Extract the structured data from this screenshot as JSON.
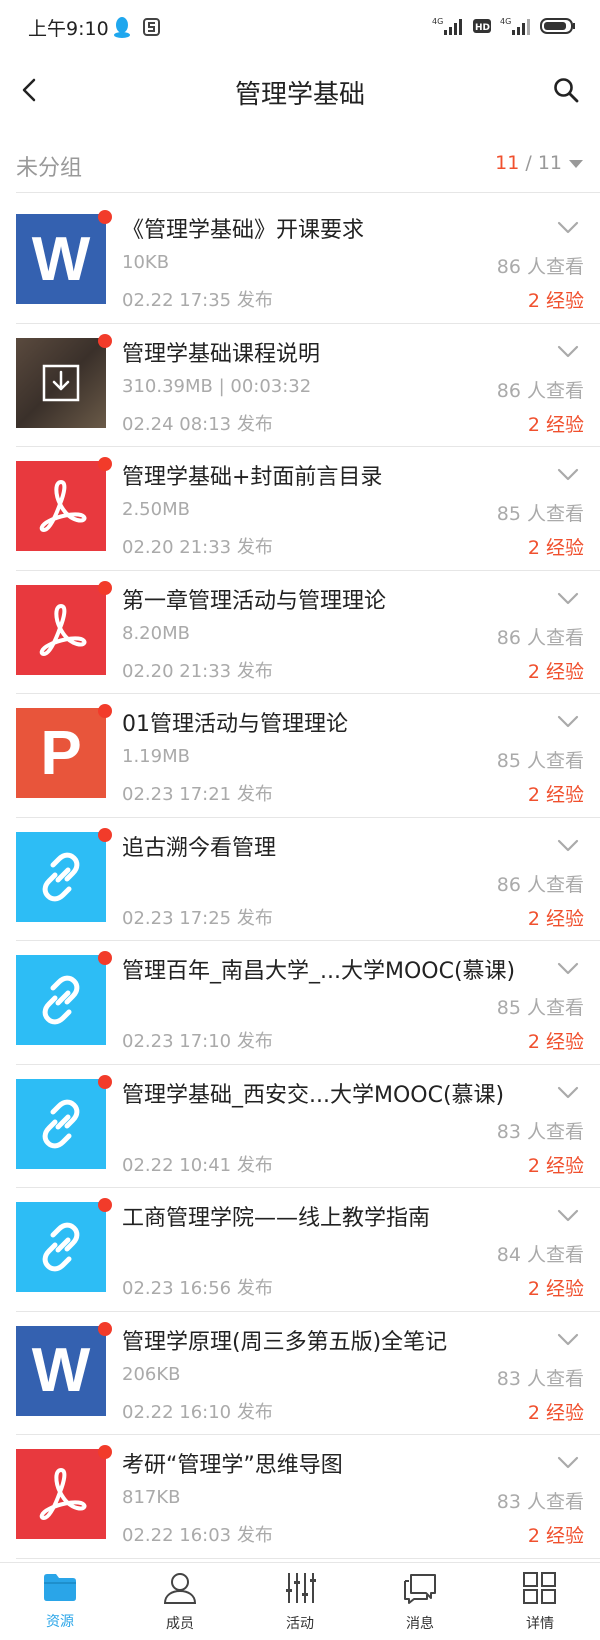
{
  "status": {
    "time": "上午9:10",
    "net1": "4G",
    "hd": "HD",
    "net2": "4G"
  },
  "header": {
    "title": "管理学基础"
  },
  "group": {
    "name": "未分组",
    "current": "11",
    "separator": " / ",
    "total": "11"
  },
  "items": [
    {
      "type": "word",
      "title": "《管理学基础》开课要求",
      "size": "10KB",
      "date": "02.22 17:35 发布",
      "views": "86 人查看",
      "exp": "2 经验"
    },
    {
      "type": "video",
      "title": "管理学基础课程说明",
      "size": "310.39MB | 00:03:32",
      "date": "02.24 08:13 发布",
      "views": "86 人查看",
      "exp": "2 经验"
    },
    {
      "type": "pdf",
      "title": "管理学基础+封面前言目录",
      "size": "2.50MB",
      "date": "02.20 21:33 发布",
      "views": "85 人查看",
      "exp": "2 经验"
    },
    {
      "type": "pdf",
      "title": "第一章管理活动与管理理论",
      "size": "8.20MB",
      "date": "02.20 21:33 发布",
      "views": "86 人查看",
      "exp": "2 经验"
    },
    {
      "type": "ppt",
      "title": "01管理活动与管理理论",
      "size": "1.19MB",
      "date": "02.23 17:21 发布",
      "views": "85 人查看",
      "exp": "2 经验"
    },
    {
      "type": "link",
      "title": "追古溯今看管理",
      "size": "",
      "date": "02.23 17:25 发布",
      "views": "86 人查看",
      "exp": "2 经验"
    },
    {
      "type": "link",
      "title": "管理百年_南昌大学_...大学MOOC(慕课)",
      "size": "",
      "date": "02.23 17:10 发布",
      "views": "85 人查看",
      "exp": "2 经验"
    },
    {
      "type": "link",
      "title": "管理学基础_西安交...大学MOOC(慕课)",
      "size": "",
      "date": "02.22 10:41 发布",
      "views": "83 人查看",
      "exp": "2 经验"
    },
    {
      "type": "link",
      "title": "工商管理学院——线上教学指南",
      "size": "",
      "date": "02.23 16:56 发布",
      "views": "84 人查看",
      "exp": "2 经验"
    },
    {
      "type": "word",
      "title": "管理学原理(周三多第五版)全笔记",
      "size": "206KB",
      "date": "02.22 16:10 发布",
      "views": "83 人查看",
      "exp": "2 经验"
    },
    {
      "type": "pdf",
      "title": "考研“管理学”思维导图",
      "size": "817KB",
      "date": "02.22 16:03 发布",
      "views": "83 人查看",
      "exp": "2 经验"
    }
  ],
  "thumb_letters": {
    "word": "W",
    "ppt": "P"
  },
  "nav": [
    {
      "label": "资源",
      "icon": "folder-icon",
      "active": true
    },
    {
      "label": "成员",
      "icon": "person-icon",
      "active": false
    },
    {
      "label": "活动",
      "icon": "sliders-icon",
      "active": false
    },
    {
      "label": "消息",
      "icon": "chat-icon",
      "active": false
    },
    {
      "label": "详情",
      "icon": "grid-icon",
      "active": false
    }
  ],
  "colors": {
    "accent": "#f0502e",
    "nav_active": "#2aa5e8",
    "word": "#3461b0",
    "pdf": "#e8393e",
    "ppt": "#e8553b",
    "link": "#2dbdf5",
    "unread_dot": "#f23b2a"
  }
}
